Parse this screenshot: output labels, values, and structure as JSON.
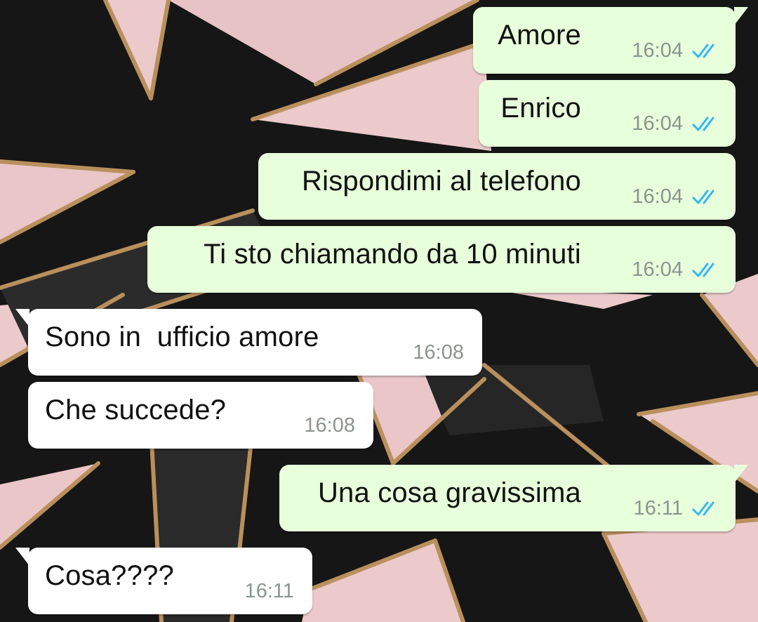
{
  "colors": {
    "outgoing_bubble": "#e7ffdb",
    "incoming_bubble": "#ffffff",
    "read_ticks": "#34b7f1",
    "timestamp": "#8a958e",
    "wallpaper_pink": "#ecc9cb",
    "wallpaper_black": "#161616",
    "wallpaper_gold": "#b98f5c"
  },
  "messages": [
    {
      "direction": "outgoing",
      "text": "Amore",
      "time": "16:04",
      "status": "read-double-check-icon"
    },
    {
      "direction": "outgoing",
      "text": "Enrico",
      "time": "16:04",
      "status": "read-double-check-icon"
    },
    {
      "direction": "outgoing",
      "text": "Rispondimi al telefono",
      "time": "16:04",
      "status": "read-double-check-icon"
    },
    {
      "direction": "outgoing",
      "text": "Ti sto chiamando da 10 minuti",
      "time": "16:04",
      "status": "read-double-check-icon"
    },
    {
      "direction": "incoming",
      "text": "Sono in  ufficio amore",
      "time": "16:08"
    },
    {
      "direction": "incoming",
      "text": "Che succede?",
      "time": "16:08"
    },
    {
      "direction": "outgoing",
      "text": "Una cosa gravissima",
      "time": "16:11",
      "status": "read-double-check-icon"
    },
    {
      "direction": "incoming",
      "text": "Cosa????",
      "time": "16:11"
    }
  ]
}
